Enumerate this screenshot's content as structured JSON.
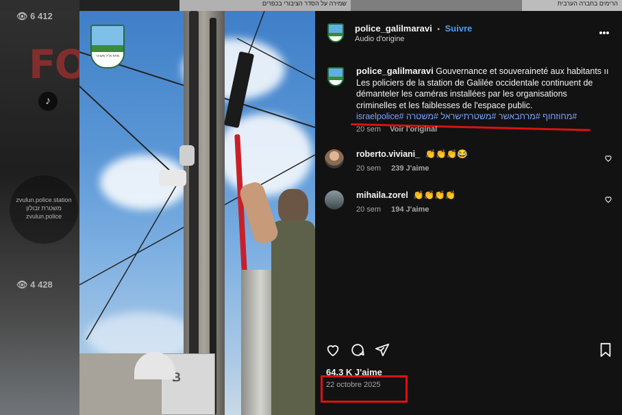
{
  "background": {
    "view_count_top": "6 412",
    "view_count_bottom": "4 428",
    "station_name": "zvulun.police.station",
    "station_hebrew": "משטרת זבולון",
    "station_handle": "zvulun.police",
    "top_hebrew_1": "שמירה על הסדר הציבורי בכפרים",
    "top_hebrew_2": "הרימים בחברה הערבית"
  },
  "post": {
    "username": "police_galilmaravi",
    "separator": "•",
    "follow_label": "Suivre",
    "audio_label": "Audio d'origine",
    "more_icon": "more-horizontal-icon"
  },
  "caption": {
    "username": "police_galilmaravi",
    "text": "Gouvernance et souveraineté aux habitants  ıı Les policiers de la station de Galilée occidentale continuent de démanteler les caméras installées par les organisations criminelles et les faiblesses de l'espace public.",
    "hashtags": "#מחוזחוף #מרחבאשר #משטרתישראל #משטרה #israelpolice",
    "time": "20 sem",
    "see_original": "Voir l'original"
  },
  "comments": [
    {
      "username": "roberto.viviani_",
      "text": "👏👏👏😂",
      "time": "20 sem",
      "likes": "239 J'aime"
    },
    {
      "username": "mihaila.zorel",
      "text": "👏👏👏👏",
      "time": "20 sem",
      "likes": "194 J'aime"
    }
  ],
  "actions": {
    "like_icon": "heart-icon",
    "comment_icon": "comment-icon",
    "share_icon": "send-icon",
    "save_icon": "bookmark-icon"
  },
  "footer": {
    "likes": "64.3 K J'aime",
    "date": "22 octobre 2025"
  },
  "colors": {
    "panel_bg": "#121212",
    "link_blue": "#4c9cf5",
    "hashtag_blue": "#7aa7ff",
    "annotation_red": "#d11111"
  }
}
